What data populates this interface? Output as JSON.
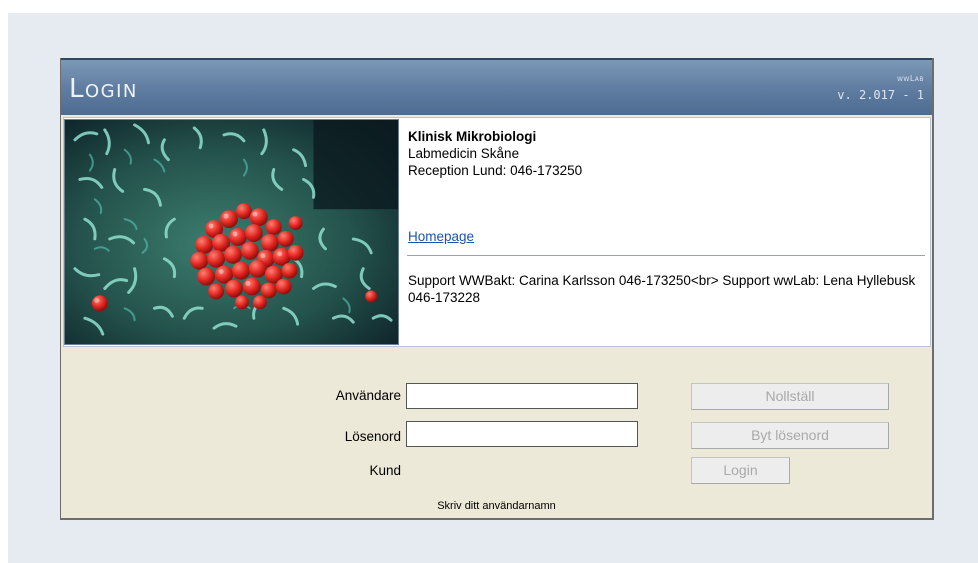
{
  "header": {
    "title": "Login",
    "brand": "wwLab",
    "version": "v. 2.017 - 1"
  },
  "info": {
    "org_name": "Klinisk Mikrobiologi",
    "dept": "Labmedicin Skåne",
    "reception": "Reception Lund: 046-173250",
    "homepage_link": "Homepage",
    "support": "Support WWBakt: Carina Karlsson 046-173250<br> Support wwLab: Lena Hyllebusk 046-173228"
  },
  "form": {
    "username_label": "Användare",
    "password_label": "Lösenord",
    "customer_label": "Kund",
    "username_value": "",
    "password_value": "",
    "hint": "Skriv ditt användarnamn"
  },
  "buttons": {
    "reset": "Nollställ",
    "change_password": "Byt lösenord",
    "login": "Login"
  },
  "colors": {
    "header_blue": "#5e7ca0",
    "panel_bg": "#ece9d8",
    "page_bg": "#e6ebf1",
    "link": "#1c53b0"
  }
}
